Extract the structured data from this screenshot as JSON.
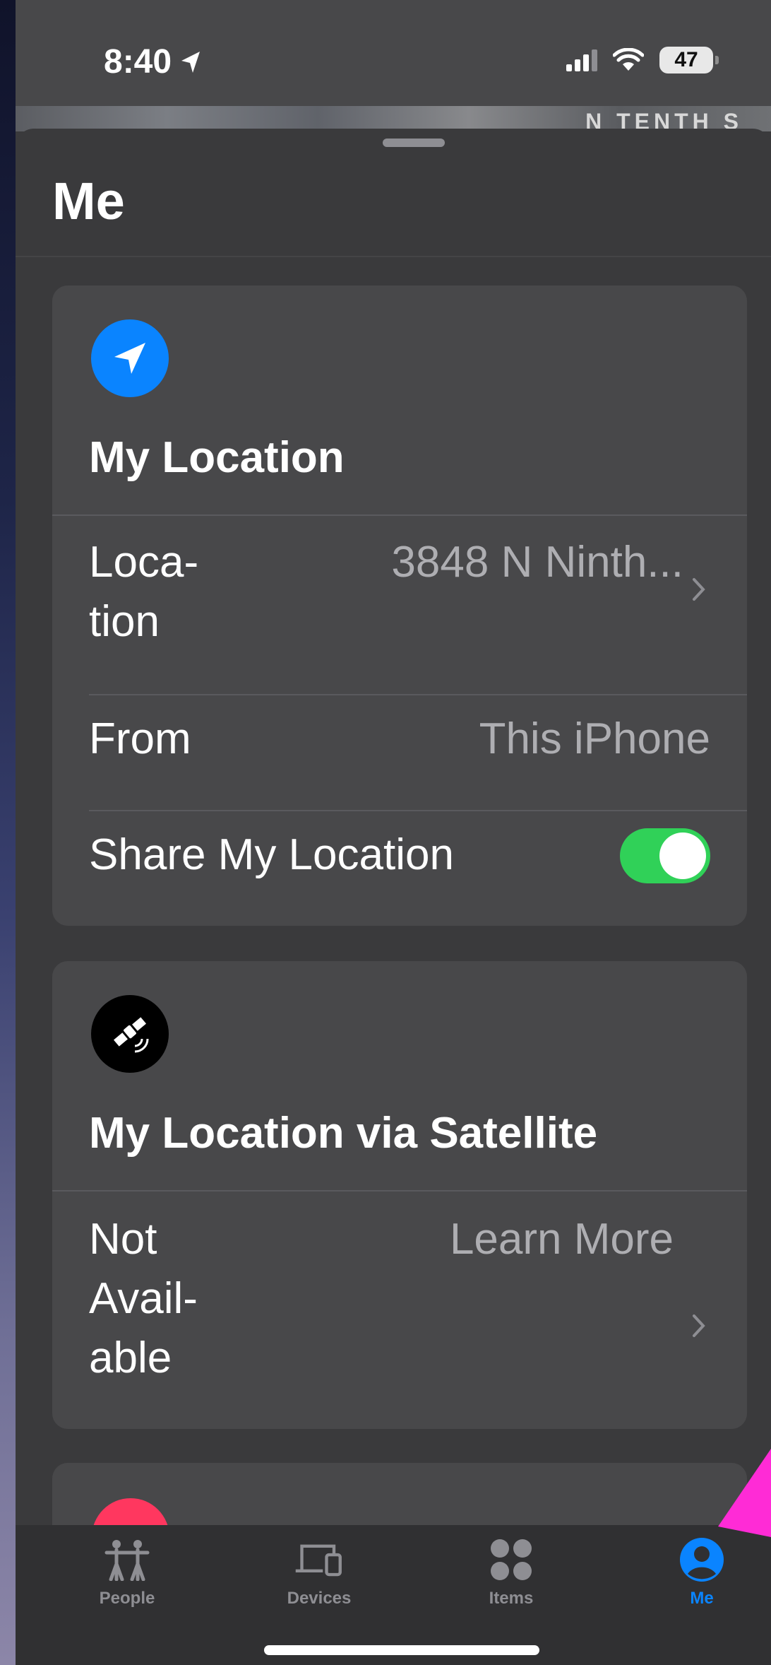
{
  "status_bar": {
    "time": "8:40",
    "battery": "47",
    "icons": [
      "location-arrow-icon",
      "signal-icon",
      "wifi-icon",
      "battery-icon"
    ]
  },
  "map": {
    "label": "N TENTH S"
  },
  "sheet": {
    "title": "Me"
  },
  "my_location": {
    "icon": "location-arrow-icon",
    "icon_color": "#0a84ff",
    "heading": "My Location",
    "rows": [
      {
        "label": "Loca-\ntion",
        "value": "3848 N Ninth..."
      },
      {
        "label": "From",
        "value": "This iPhone"
      },
      {
        "label": "Share My Location",
        "value": "on"
      }
    ]
  },
  "satellite": {
    "icon": "satellite-icon",
    "heading": "My Location via Satellite",
    "row": {
      "label": "Not\nAvail-\nable",
      "value": "Learn More"
    }
  },
  "tab_bar": {
    "tabs": [
      {
        "label": "People",
        "icon": "people-icon"
      },
      {
        "label": "Devices",
        "icon": "devices-icon"
      },
      {
        "label": "Items",
        "icon": "items-icon"
      },
      {
        "label": "Me",
        "icon": "person-circle-icon",
        "active": true
      }
    ],
    "active_color": "#0a84ff"
  },
  "colors": {
    "toggle_on": "#30d158",
    "annotation_arrow": "#ff2bd6"
  }
}
